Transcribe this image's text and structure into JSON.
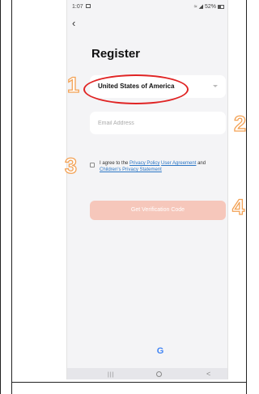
{
  "status_bar": {
    "time": "1:07",
    "battery": "52%"
  },
  "page": {
    "title": "Register"
  },
  "form": {
    "country": "United States of America",
    "email_placeholder": "Email Address",
    "agree_prefix": "I agree to the",
    "privacy_policy_link": "Privacy Policy",
    "user_agreement_link": "User Agreement",
    "agree_and": "and",
    "childrens_privacy_link": "Children's Privacy Statement",
    "submit_label": "Get Verification Code"
  },
  "social": {
    "google_label": "G"
  },
  "nav_bar": {
    "recent_label": "|||",
    "back_label": "<"
  },
  "annotations": {
    "steps": [
      "1",
      "2",
      "3",
      "4"
    ],
    "highlight_color": "#e02424",
    "number_color": "#f3a255"
  },
  "colors": {
    "button_disabled": "#f6c7bb",
    "link": "#2b76c5",
    "screen_bg": "#f4f4f6"
  }
}
